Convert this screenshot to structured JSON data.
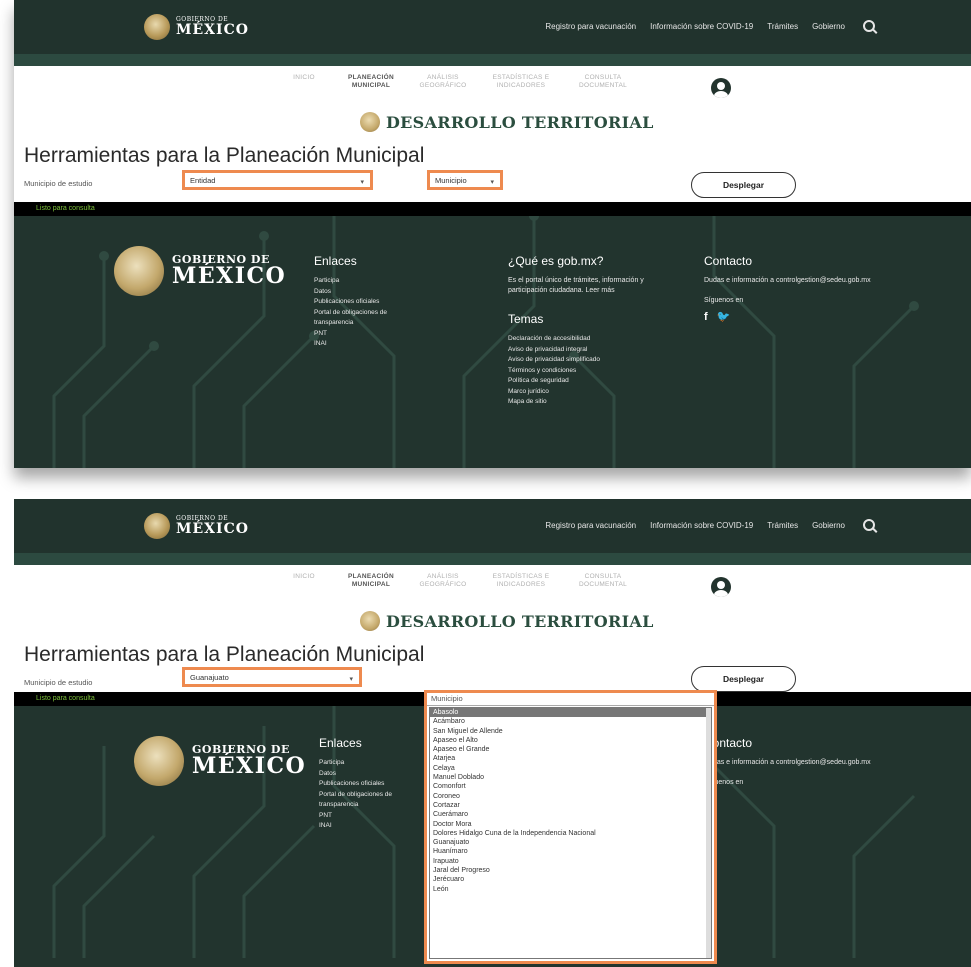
{
  "header": {
    "logo_small": "GOBIERNO DE",
    "logo_big": "MÉXICO",
    "nav": [
      "Registro para vacunación",
      "Información sobre COVID-19",
      "Trámites",
      "Gobierno"
    ],
    "search_icon": "search-icon"
  },
  "subnav": [
    {
      "label": "INICIO",
      "active": false
    },
    {
      "label": "PLANEACIÓN MUNICIPAL",
      "active": true
    },
    {
      "label": "ANÁLISIS GEOGRÁFICO",
      "active": false
    },
    {
      "label": "ESTADÍSTICAS E INDICADORES",
      "active": false
    },
    {
      "label": "CONSULTA DOCUMENTAL",
      "active": false
    }
  ],
  "section_title": "DESARROLLO TERRITORIAL",
  "page_title": "Herramientas para la Planeación Municipal",
  "form": {
    "label": "Municipio de estudio",
    "entidad_value_1": "Entidad",
    "entidad_value_2": "Guanajuato",
    "municipio_value": "Municipio",
    "municipio_placeholder": "Municipio",
    "button": "Desplegar"
  },
  "status_text": "Listo para consulta",
  "footer": {
    "logo_small": "GOBIERNO DE",
    "logo_big": "MÉXICO",
    "enlaces_title": "Enlaces",
    "enlaces": [
      "Participa",
      "Datos",
      "Publicaciones oficiales",
      "Portal de obligaciones de transparencia",
      "PNT",
      "INAI"
    ],
    "que_es_title": "¿Qué es gob.mx?",
    "que_es_text": "Es el portal único de trámites, información y participación ciudadana. Leer más",
    "temas_title": "Temas",
    "temas": [
      "Declaración de accesibilidad",
      "Aviso de privacidad integral",
      "Aviso de privacidad simplificado",
      "Términos y condiciones",
      "Política de seguridad",
      "Marco jurídico",
      "Mapa de sitio"
    ],
    "contacto_title": "Contacto",
    "contacto_text": "Dudas e información a controlgestion@sedeu.gob.mx",
    "siguenos": "Síguenos en",
    "social": "f 🐦"
  },
  "dropdown_options": [
    "Abasolo",
    "Acámbaro",
    "San Miguel de Allende",
    "Apaseo el Alto",
    "Apaseo el Grande",
    "Atarjea",
    "Celaya",
    "Manuel Doblado",
    "Comonfort",
    "Coroneo",
    "Cortazar",
    "Cuerámaro",
    "Doctor Mora",
    "Dolores Hidalgo Cuna de la Independencia Nacional",
    "Guanajuato",
    "Huanímaro",
    "Irapuato",
    "Jaral del Progreso",
    "Jerécuaro",
    "León"
  ],
  "dropdown_selected": "Abasolo",
  "colors": {
    "dark_green": "#21332d",
    "accent_orange": "#ee8a4f",
    "status_green": "#7ec23a"
  }
}
